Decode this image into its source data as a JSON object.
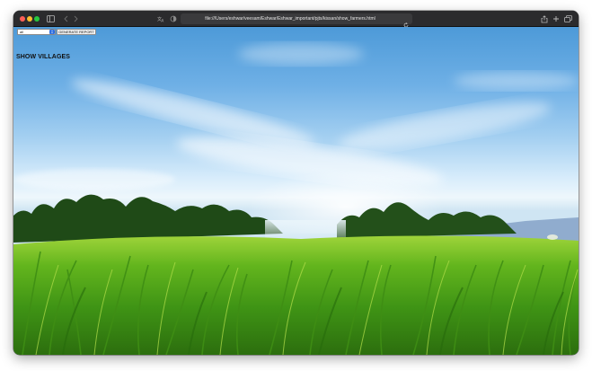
{
  "browser": {
    "address_url": "file:///Users/eshwar/veesam/Eshwar/Eshwar_important/pjts/kissan/show_farmers.html"
  },
  "page": {
    "filter_select": {
      "selected_value": "all"
    },
    "generate_report_label": "GENERATE REPORT",
    "heading": "SHOW VILLAGES"
  },
  "colors": {
    "sky_top": "#4d9ad8",
    "grass": "#4fae1c",
    "select_arrow_accent": "#2f6fe0"
  },
  "icons": [
    "sidebar-icon",
    "back-icon",
    "forward-icon",
    "translate-icon",
    "shield-icon",
    "reload-icon",
    "share-icon",
    "new-tab-icon",
    "tab-overview-icon",
    "chevron-updown-icon"
  ]
}
